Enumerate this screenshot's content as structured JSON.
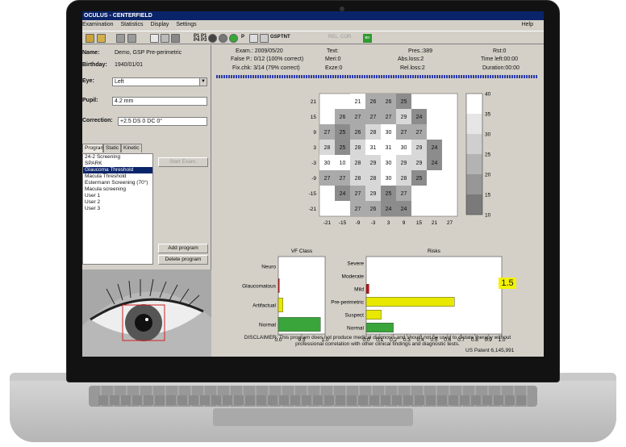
{
  "window": {
    "title": "OCULUS - CENTERFIELD",
    "help_menu": "Help"
  },
  "menu": [
    "Examination",
    "Statistics",
    "Display",
    "Settings"
  ],
  "toolbar": {
    "items": [
      "folder-icon",
      "open-icon",
      "print-icon",
      "print-preview-icon",
      "window-icon",
      "grid-icon",
      "grid-alt-icon",
      "table-icon"
    ],
    "text_labels": {
      "t1": "P1 P1\nP4 P3",
      "psym": "P",
      "gsp": "GSP",
      "tnt": "TNT",
      "rel": "REL.",
      "cor": "COR."
    }
  },
  "patient": {
    "name_label": "Name:",
    "name_value": "Demo, GSP Pre-perimetric",
    "birthday_label": "Birthday:",
    "birthday_value": "1940/01/01",
    "eye_label": "Eye:",
    "eye_value": "Left",
    "pupil_label": "Pupil:",
    "pupil_value": "4.2 mm",
    "correction_label": "Correction:",
    "correction_value": "+2.5 DS 0 DC 0°"
  },
  "tabs": [
    "Program",
    "Static",
    "Kinetic"
  ],
  "programs": {
    "items": [
      "24-2 Screening",
      "SPARK",
      "Glaucoma Threshold",
      "Macula Threshold",
      "Estermann Screening (70°)",
      "Macula screening",
      "User 1",
      "User 2",
      "User 3"
    ],
    "selected_index": 2
  },
  "buttons": {
    "start_exam": "Start Exam.",
    "add_program": "Add program",
    "delete_program": "Delete program"
  },
  "exam": {
    "exam_label": "Exam.:",
    "exam_value": "2009/05/20",
    "false_pos_label": "False P.:",
    "false_pos_value": "0/12 (100% correct)",
    "fix_chk_label": "Fix.chk:",
    "fix_chk_value": "3/14 (79% correct)",
    "text_label": "Text:",
    "meri_label": "Meri:",
    "meri_value": "0",
    "exze_label": "Exze:",
    "exze_value": "0",
    "pres_label": "Pres.:",
    "pres_value": "389",
    "abs_loss_label": "Abs.loss:",
    "abs_loss_value": "2",
    "rel_loss_label": "Rel.loss:",
    "rel_loss_value": "2",
    "rst_label": "Rst:",
    "rst_value": "0",
    "time_left_label": "Time left:",
    "time_left_value": "00:00",
    "duration_label": "Duration:",
    "duration_value": "00:00"
  },
  "grid_map": {
    "x_ticks": [
      "-21",
      "-15",
      "-9",
      "-3",
      "3",
      "9",
      "15",
      "21",
      "27"
    ],
    "y_ticks": [
      "21",
      "15",
      "9",
      "3",
      "-3",
      "-9",
      "-15",
      "-21"
    ],
    "rows": [
      [
        "",
        "",
        "21",
        "26",
        "26",
        "25",
        "",
        "",
        ""
      ],
      [
        "",
        "26",
        "27",
        "27",
        "27",
        "29",
        "24",
        "",
        ""
      ],
      [
        "27",
        "25",
        "26",
        "28",
        "30",
        "27",
        "27",
        "",
        ""
      ],
      [
        "28",
        "25",
        "28",
        "31",
        "31",
        "30",
        "29",
        "24",
        ""
      ],
      [
        "30",
        "10",
        "28",
        "29",
        "30",
        "29",
        "29",
        "24",
        ""
      ],
      [
        "27",
        "27",
        "28",
        "28",
        "30",
        "28",
        "25",
        "",
        ""
      ],
      [
        "",
        "24",
        "27",
        "29",
        "25",
        "27",
        "",
        "",
        ""
      ],
      [
        "",
        "",
        "27",
        "26",
        "24",
        "24",
        "",
        "",
        ""
      ]
    ],
    "colorbar_ticks": [
      "40",
      "35",
      "30",
      "25",
      "20",
      "15",
      "10"
    ]
  },
  "chart_data": [
    {
      "type": "bar",
      "title": "VF Class",
      "categories": [
        "Normal",
        "Artifactual",
        "Glaucomatous",
        "Neuro"
      ],
      "values": [
        0.9,
        0.1,
        0.02,
        0
      ],
      "colors": [
        "#3aa53a",
        "#e8e800",
        "#c01010",
        "#c0c0c0"
      ],
      "xlim": [
        0,
        1
      ],
      "x_ticks": [
        "0.0",
        "0.5",
        "1.0"
      ]
    },
    {
      "type": "bar",
      "title": "Risks",
      "categories": [
        "Normal",
        "Suspect",
        "Pre-perimetric",
        "Mild",
        "Moderate",
        "Severe"
      ],
      "values": [
        0.2,
        0.11,
        0.65,
        0.02,
        0,
        0
      ],
      "colors": [
        "#3aa53a",
        "#e8e800",
        "#e8e800",
        "#c01010",
        "#c0c0c0",
        "#c0c0c0"
      ],
      "xlim": [
        0,
        1
      ],
      "x_ticks": [
        "0.0",
        "0.1",
        "0.2",
        "0.3",
        "0.4",
        "0.5",
        "0.6",
        "0.7",
        "0.8",
        "0.9",
        "1.0"
      ],
      "score": "1.5"
    }
  ],
  "disclaimer": "DISCLAIMER: This program does not produce medical diagnosis and should not be used to dictate therapy without professional correlation with other clinical findings and diagnostic tests.",
  "patent": "US Patent 6,145,991"
}
